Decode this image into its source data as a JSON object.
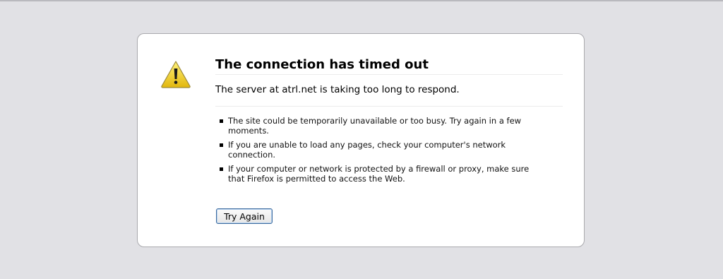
{
  "error": {
    "title": "The connection has timed out",
    "short_desc": "The server at atrl.net is taking too long to respond.",
    "suggestions": [
      "The site could be temporarily unavailable or too busy. Try again in a few moments.",
      "If you are unable to load any pages, check your computer's network connection.",
      "If your computer or network is protected by a firewall or proxy, make sure that Firefox is permitted to access the Web."
    ],
    "icon": "warning-icon"
  },
  "actions": {
    "try_again_label": "Try Again"
  },
  "colors": {
    "page_background": "#e1e1e5",
    "box_background": "#ffffff",
    "warning_fill": "#f2d21e",
    "button_border": "#3c6a9e"
  }
}
